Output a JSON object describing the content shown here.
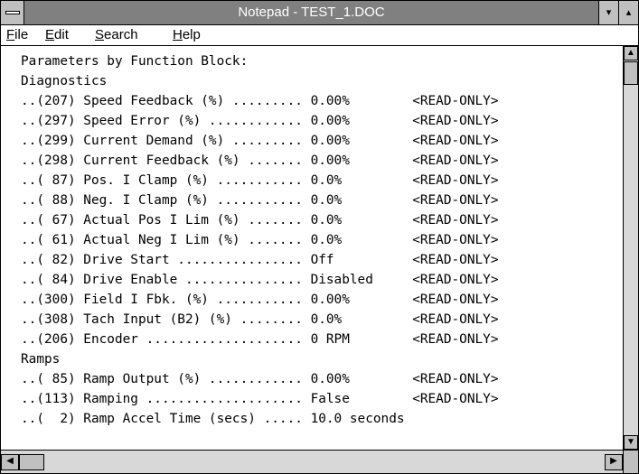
{
  "window": {
    "title": "Notepad - TEST_1.DOC"
  },
  "titlebar": {
    "minimize_glyph": "▾",
    "maximize_glyph": "▴"
  },
  "menu": [
    {
      "label": "File",
      "underline": "F"
    },
    {
      "label": "Edit",
      "underline": "E"
    },
    {
      "label": "Search",
      "underline": "S"
    },
    {
      "label": "Help",
      "underline": "H"
    }
  ],
  "document": {
    "lines": [
      "Parameters by Function Block:",
      "Diagnostics",
      "..(207) Speed Feedback (%) ......... 0.00%        <READ-ONLY>",
      "..(297) Speed Error (%) ............ 0.00%        <READ-ONLY>",
      "..(299) Current Demand (%) ......... 0.00%        <READ-ONLY>",
      "..(298) Current Feedback (%) ....... 0.00%        <READ-ONLY>",
      "..( 87) Pos. I Clamp (%) ........... 0.0%         <READ-ONLY>",
      "..( 88) Neg. I Clamp (%) ........... 0.0%         <READ-ONLY>",
      "..( 67) Actual Pos I Lim (%) ....... 0.0%         <READ-ONLY>",
      "..( 61) Actual Neg I Lim (%) ....... 0.0%         <READ-ONLY>",
      "..( 82) Drive Start ................ Off          <READ-ONLY>",
      "..( 84) Drive Enable ............... Disabled     <READ-ONLY>",
      "..(300) Field I Fbk. (%) ........... 0.00%        <READ-ONLY>",
      "..(308) Tach Input (B2) (%) ........ 0.0%         <READ-ONLY>",
      "..(206) Encoder .................... 0 RPM        <READ-ONLY>",
      "Ramps",
      "..( 85) Ramp Output (%) ............ 0.00%        <READ-ONLY>",
      "..(113) Ramping .................... False        <READ-ONLY>",
      "..(  2) Ramp Accel Time (secs) ..... 10.0 seconds"
    ]
  },
  "scrollbar": {
    "up": "▲",
    "down": "▼",
    "left": "◀",
    "right": "▶"
  }
}
